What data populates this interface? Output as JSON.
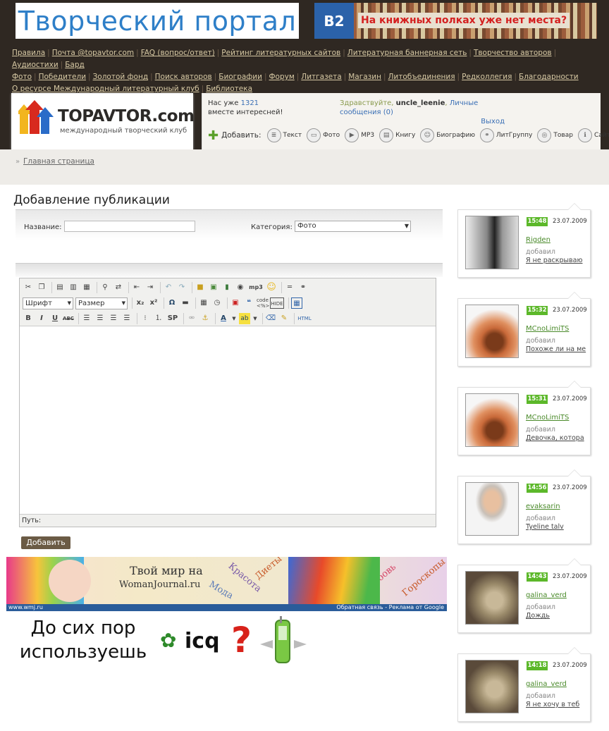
{
  "banners": {
    "left_title": "Творческий портал",
    "right_logo": "B2",
    "right_text": "На книжных полках уже нет места?"
  },
  "nav": [
    "Правила",
    "Почта @topavtor.com",
    "FAQ (вопрос/ответ)",
    "Рейтинг литературных сайтов",
    "Литературная баннерная сеть",
    "Творчество авторов",
    "Аудиостихи",
    "Бард",
    "Фото",
    "Победители",
    "Золотой фонд",
    "Поиск авторов",
    "Биографии",
    "Форум",
    "Литгазета",
    "Магазин",
    "Литобъединения",
    "Редколлегия",
    "Благодарности",
    "О ресурсе Международный литературный клуб",
    "Библиотека"
  ],
  "logo": {
    "title": "TOPAVTOR.com",
    "subtitle": "международный творческий клуб"
  },
  "info": {
    "count_prefix": "Нас уже",
    "count": "1321",
    "count_suffix": "вместе интересней!",
    "greeting": "Здравствуйте,",
    "username": "uncle_leenie",
    "messages": "Личные сообщения (0)",
    "logout": "Выход"
  },
  "add_bar": {
    "label": "Добавить:",
    "items": [
      "Текст",
      "Фото",
      "MP3",
      "Книгу",
      "Биографию",
      "ЛитГруппу",
      "Товар",
      "Сайт"
    ]
  },
  "breadcrumb": {
    "home": "Главная страница",
    "marker": "»"
  },
  "page": {
    "title": "Добавление публикации"
  },
  "form": {
    "name_label": "Название:",
    "name_value": "",
    "category_label": "Категория:",
    "category_value": "Фото",
    "font_select": "Шрифт",
    "size_select": "Размер",
    "path_label": "Путь:",
    "submit": "Добавить"
  },
  "ads": {
    "woman_line1": "Твой мир на",
    "woman_line2": "WomanJournal.ru",
    "woman_words": [
      "Мода",
      "Красота",
      "Диеты",
      "Любовь",
      "Гороскопы"
    ],
    "woman_footer_left": "www.wmj.ru",
    "woman_footer_right": "Обратная связь - Реклама от Google",
    "icq_text_line1": "До сих пор",
    "icq_text_line2": "используешь",
    "icq_word": "icq",
    "icq_q": "?"
  },
  "sidebar": [
    {
      "time": "15:48",
      "date": "23.07.2009",
      "user": "Rigden",
      "action": "добавил",
      "work": "Я не раскрываю"
    },
    {
      "time": "15:32",
      "date": "23.07.2009",
      "user": "MCnoLimiTS",
      "action": "добавил",
      "work": "Похоже ли на ме"
    },
    {
      "time": "15:31",
      "date": "23.07.2009",
      "user": "MCnoLimiTS",
      "action": "добавил",
      "work": "Девочка, котора"
    },
    {
      "time": "14:56",
      "date": "23.07.2009",
      "user": "evaksarin",
      "action": "добавил",
      "work": "Tyeline talv"
    },
    {
      "time": "14:43",
      "date": "23.07.2009",
      "user": "galina_verd",
      "action": "добавил",
      "work": "Дождь"
    },
    {
      "time": "14:18",
      "date": "23.07.2009",
      "user": "galina_verd",
      "action": "добавил",
      "work": "Я не хочу в теб"
    }
  ],
  "colors": {
    "top_bg": "#2f2822",
    "nav_link": "#d7c9a4",
    "time_badge": "#5cb82a",
    "submit": "#6b5b45"
  }
}
